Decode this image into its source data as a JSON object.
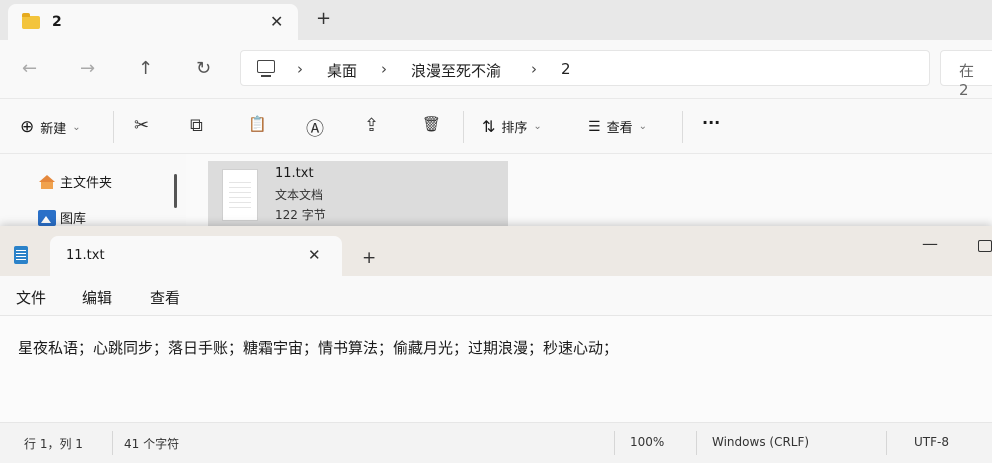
{
  "explorer": {
    "tab_title": "2",
    "tab_close": "✕",
    "new_tab": "+",
    "nav": {
      "back": "←",
      "forward": "→",
      "up": "↑",
      "refresh": "↻"
    },
    "breadcrumb": [
      "桌面",
      "浪漫至死不渝",
      "2"
    ],
    "breadcrumb_sep": "›",
    "search_placeholder": "在 2",
    "toolbar": {
      "new_label": "新建",
      "new_icon": "⊕",
      "cut_icon": "✂",
      "copy_icon": "⧉",
      "paste_icon": "📋",
      "rename_icon": "Ⓐ",
      "share_icon": "⇪",
      "delete_icon": "🗑",
      "sort_label": "排序",
      "sort_icon": "⇅",
      "view_label": "查看",
      "view_icon": "☰",
      "more_label": "···",
      "chevron": "⌄"
    },
    "sidebar": {
      "home_label": "主文件夹",
      "gallery_label": "图库"
    },
    "file": {
      "name": "11.txt",
      "type": "文本文档",
      "size": "122 字节"
    }
  },
  "notepad": {
    "tab_title": "11.txt",
    "tab_close": "✕",
    "new_tab": "+",
    "minimize": "—",
    "menu": [
      "文件",
      "编辑",
      "查看"
    ],
    "content": "星夜私语；心跳同步；落日手账；糖霜宇宙；情书算法；偷藏月光；过期浪漫；秒速心动；",
    "status": {
      "position": "行 1，列 1",
      "chars": "41 个字符",
      "zoom": "100%",
      "line_ending": "Windows (CRLF)",
      "encoding": "UTF-8"
    }
  }
}
